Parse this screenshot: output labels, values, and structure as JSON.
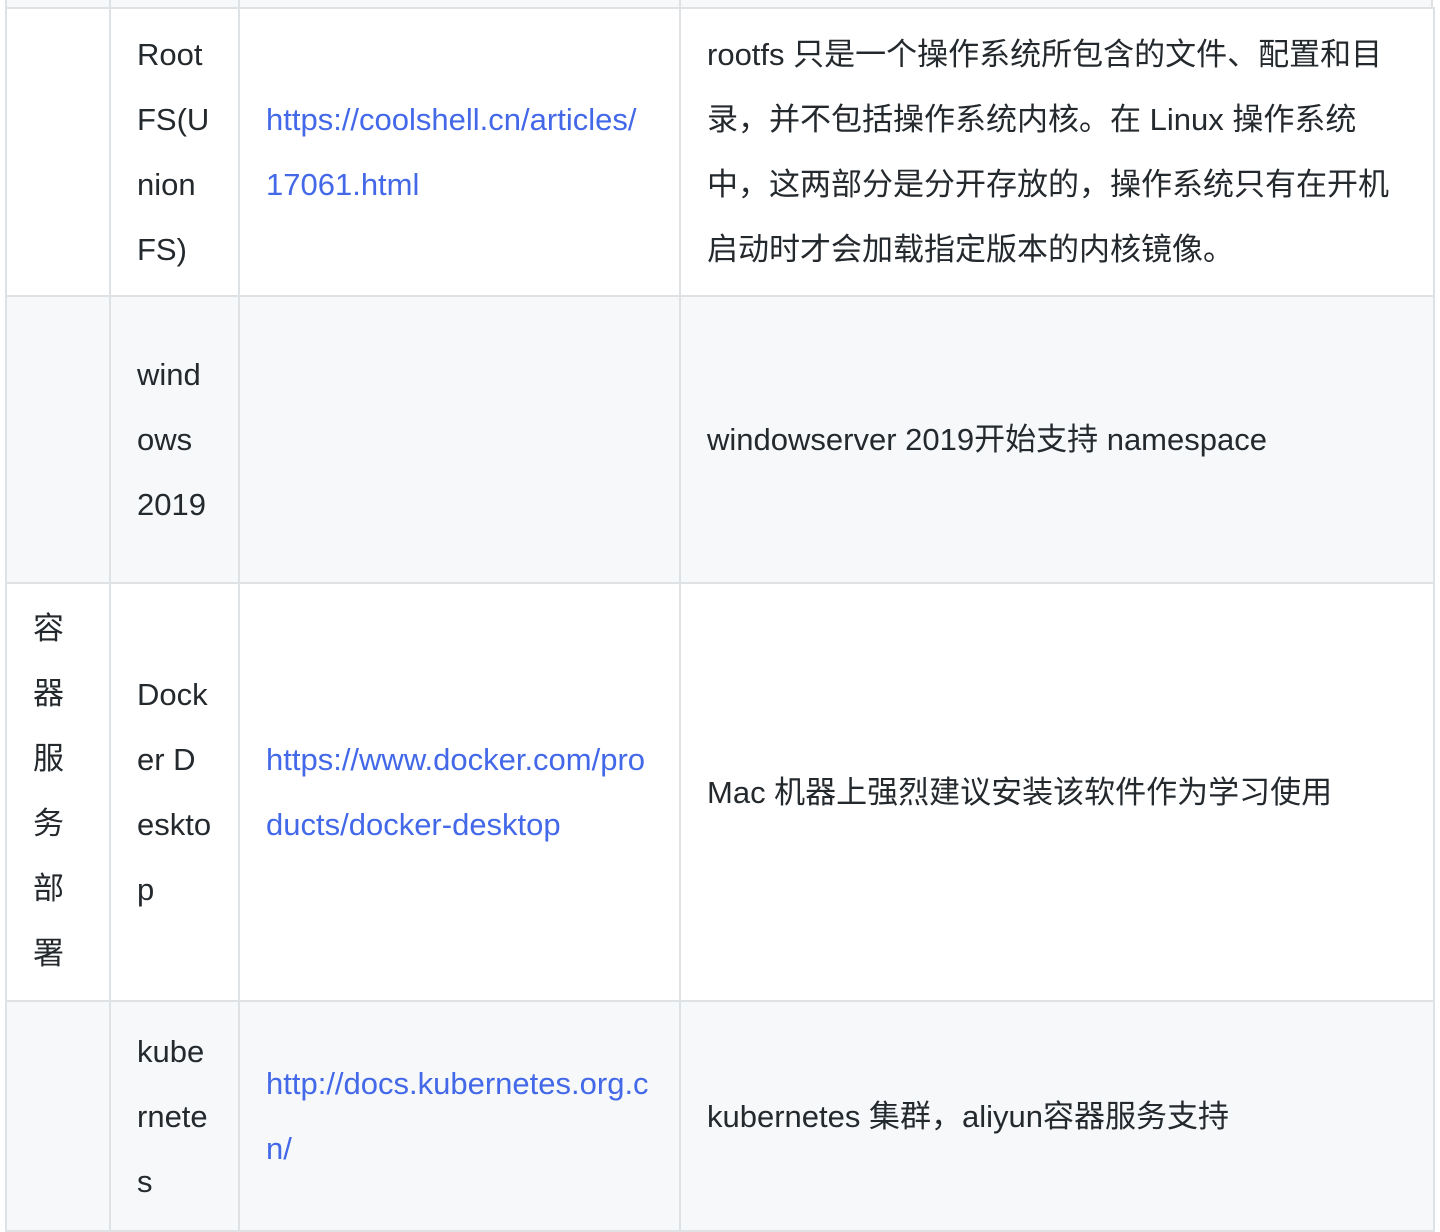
{
  "table": {
    "rows": [
      {
        "category": "",
        "name": "RootFS(UnionFS)",
        "link": "https://coolshell.cn/articles/17061.html",
        "description": "rootfs 只是一个操作系统所包含的文件、配置和目录，并不包括操作系统内核。在 Linux 操作系统中，这两部分是分开存放的，操作系统只有在开机启动时才会加载指定版本的内核镜像。"
      },
      {
        "category": "",
        "name": "windows 2019",
        "link": "",
        "description": "windowserver 2019开始支持 namespace"
      },
      {
        "category": "容器服务部署",
        "name": "Docker Desktop",
        "link": "https://www.docker.com/products/docker-desktop",
        "description": "Mac 机器上强烈建议安装该软件作为学习使用"
      },
      {
        "category": "",
        "name": "kubernetes",
        "link": "http://docs.kubernetes.org.cn/",
        "description": "kubernetes 集群，aliyun容器服务支持"
      }
    ]
  },
  "colors": {
    "border": "#dfe2e5",
    "stripe": "#f6f8fa",
    "link": "#4368e8",
    "text": "#24292e"
  }
}
